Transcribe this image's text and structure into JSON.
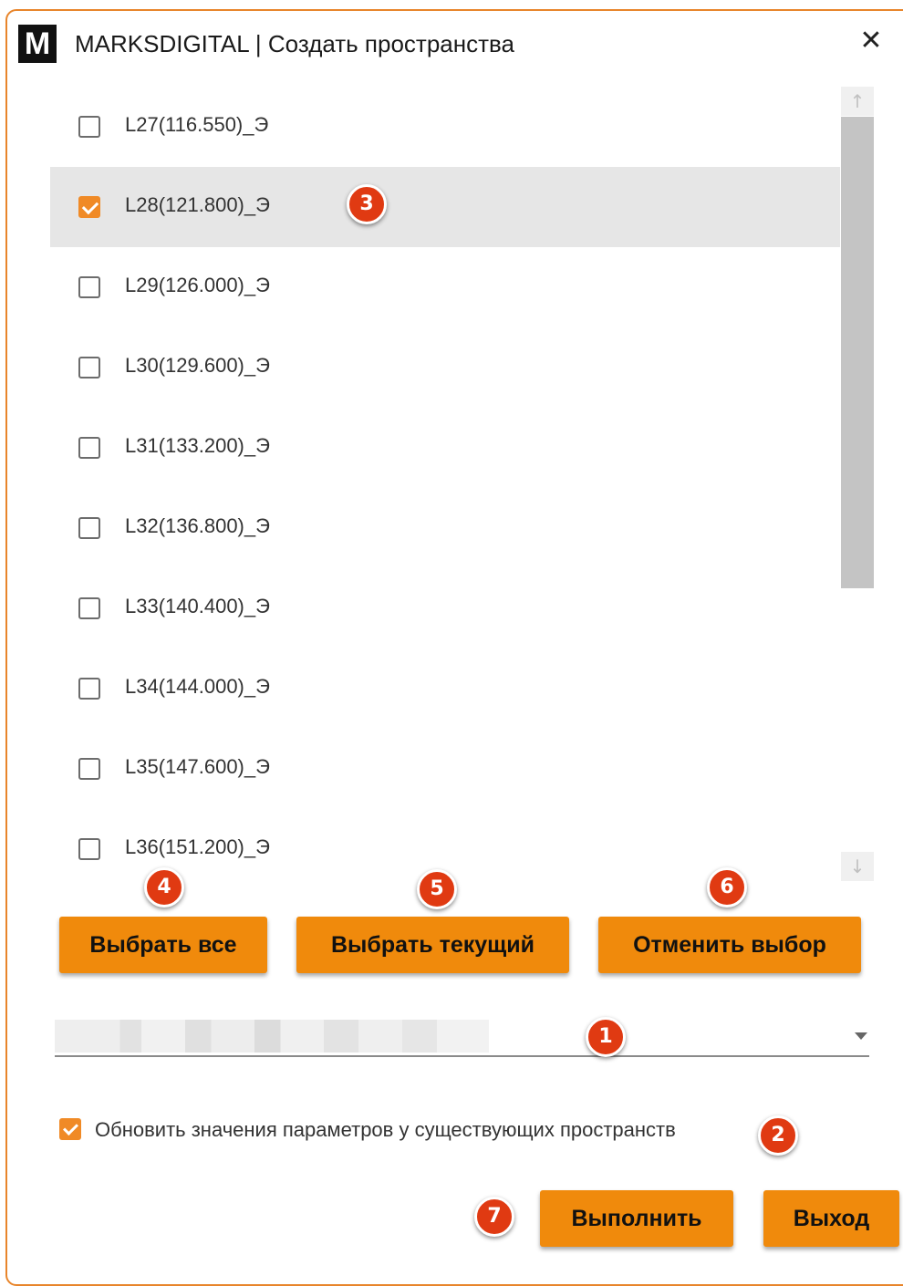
{
  "window": {
    "logo_text": "M",
    "title": "MARKSDIGITAL | Создать пространства",
    "close_label": "✕"
  },
  "levels": [
    {
      "label": "L27(116.550)_Э",
      "checked": false
    },
    {
      "label": "L28(121.800)_Э",
      "checked": true
    },
    {
      "label": "L29(126.000)_Э",
      "checked": false
    },
    {
      "label": "L30(129.600)_Э",
      "checked": false
    },
    {
      "label": "L31(133.200)_Э",
      "checked": false
    },
    {
      "label": "L32(136.800)_Э",
      "checked": false
    },
    {
      "label": "L33(140.400)_Э",
      "checked": false
    },
    {
      "label": "L34(144.000)_Э",
      "checked": false
    },
    {
      "label": "L35(147.600)_Э",
      "checked": false
    },
    {
      "label": "L36(151.200)_Э",
      "checked": false
    }
  ],
  "buttons": {
    "select_all": "Выбрать все",
    "select_current": "Выбрать текущий",
    "deselect": "Отменить выбор",
    "execute": "Выполнить",
    "exit": "Выход"
  },
  "update_checkbox": {
    "label": "Обновить значения параметров у существующих пространств",
    "checked": true
  },
  "badges": {
    "b1": "1",
    "b2": "2",
    "b3": "3",
    "b4": "4",
    "b5": "5",
    "b6": "6",
    "b7": "7"
  },
  "colors": {
    "accent": "#f08a0c",
    "badge": "#e03a12",
    "selected_row": "#e6e6e6"
  }
}
